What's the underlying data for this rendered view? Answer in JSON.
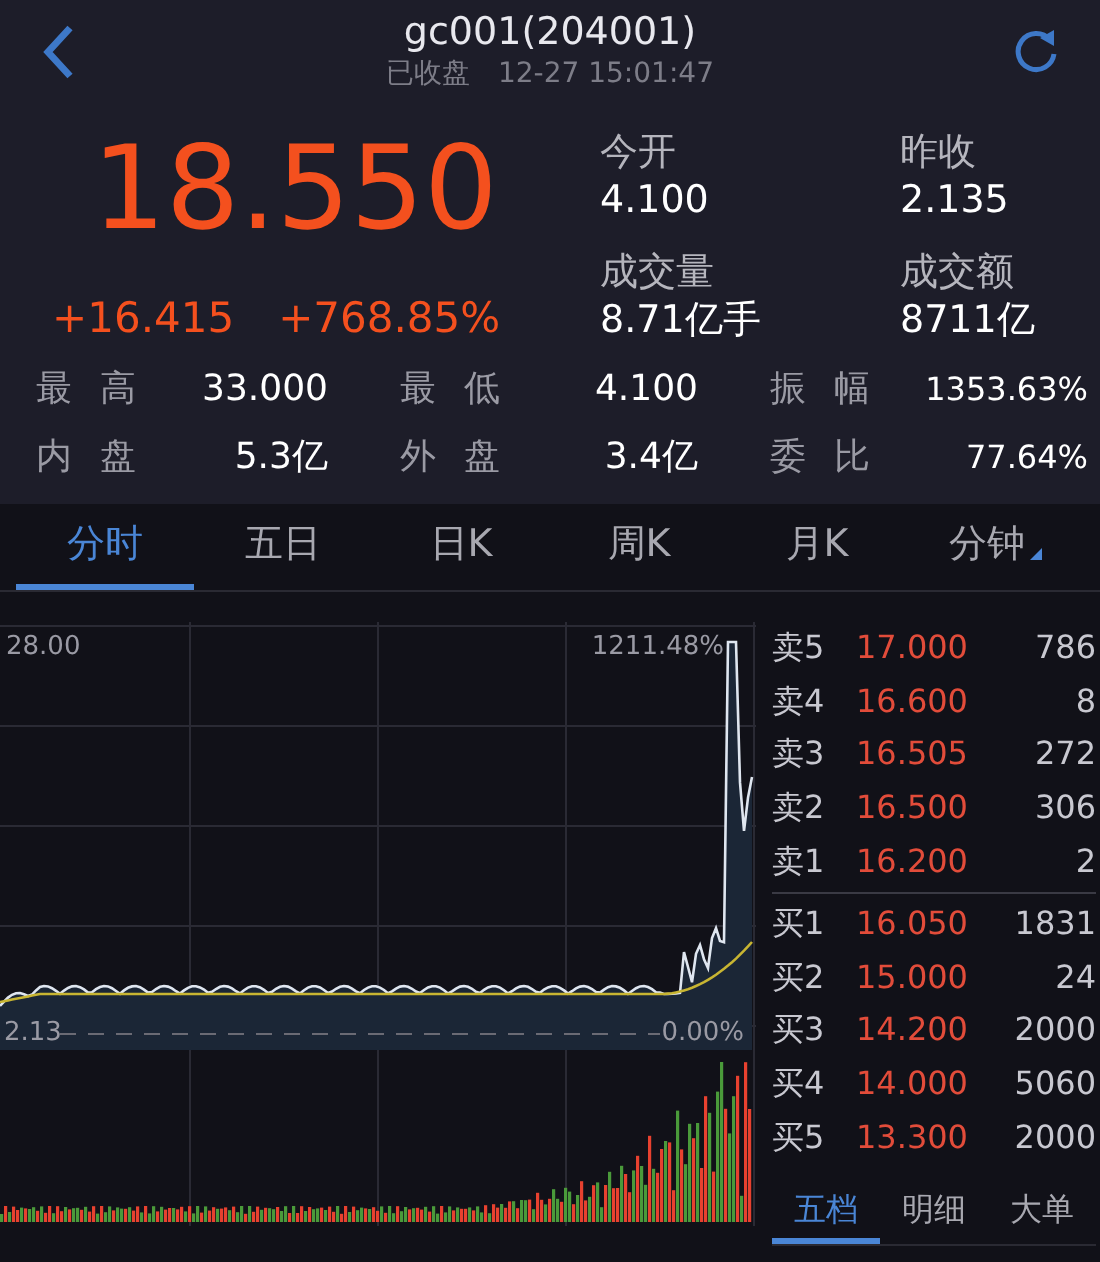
{
  "header": {
    "title": "gc001(204001)",
    "status": "已收盘",
    "time": "12-27 15:01:47"
  },
  "quote": {
    "price": "18.550",
    "change": "+16.415",
    "change_pct": "+768.85%"
  },
  "summary": [
    {
      "label": "今开",
      "value": "4.100"
    },
    {
      "label": "昨收",
      "value": "2.135"
    },
    {
      "label": "成交量",
      "value": "8.71亿手"
    },
    {
      "label": "成交额",
      "value": "8711亿"
    }
  ],
  "stats": [
    {
      "label": "最高",
      "value": "33.000"
    },
    {
      "label": "最低",
      "value": "4.100"
    },
    {
      "label": "振幅",
      "value": "1353.63%"
    },
    {
      "label": "内盘",
      "value": "5.3亿"
    },
    {
      "label": "外盘",
      "value": "3.4亿"
    },
    {
      "label": "委比",
      "value": "77.64%"
    }
  ],
  "tabs": [
    {
      "label": "分时",
      "selected": true
    },
    {
      "label": "五日",
      "selected": false
    },
    {
      "label": "日K",
      "selected": false
    },
    {
      "label": "周K",
      "selected": false
    },
    {
      "label": "月K",
      "selected": false
    },
    {
      "label": "分钟",
      "selected": false,
      "dropdown": true
    }
  ],
  "chart": {
    "top_price": "28.00",
    "top_pct": "1211.48%",
    "base_price": "2.13",
    "base_pct": "0.00%"
  },
  "order_book": {
    "asks": [
      {
        "label": "卖5",
        "price": "17.000",
        "volume": "786"
      },
      {
        "label": "卖4",
        "price": "16.600",
        "volume": "8"
      },
      {
        "label": "卖3",
        "price": "16.505",
        "volume": "272"
      },
      {
        "label": "卖2",
        "price": "16.500",
        "volume": "306"
      },
      {
        "label": "卖1",
        "price": "16.200",
        "volume": "2"
      }
    ],
    "bids": [
      {
        "label": "买1",
        "price": "16.050",
        "volume": "1831"
      },
      {
        "label": "买2",
        "price": "15.000",
        "volume": "24"
      },
      {
        "label": "买3",
        "price": "14.200",
        "volume": "2000"
      },
      {
        "label": "买4",
        "price": "14.000",
        "volume": "5060"
      },
      {
        "label": "买5",
        "price": "13.300",
        "volume": "2000"
      }
    ],
    "tabs": [
      {
        "label": "五档",
        "selected": true
      },
      {
        "label": "明细",
        "selected": false
      },
      {
        "label": "大单",
        "selected": false
      }
    ]
  }
}
